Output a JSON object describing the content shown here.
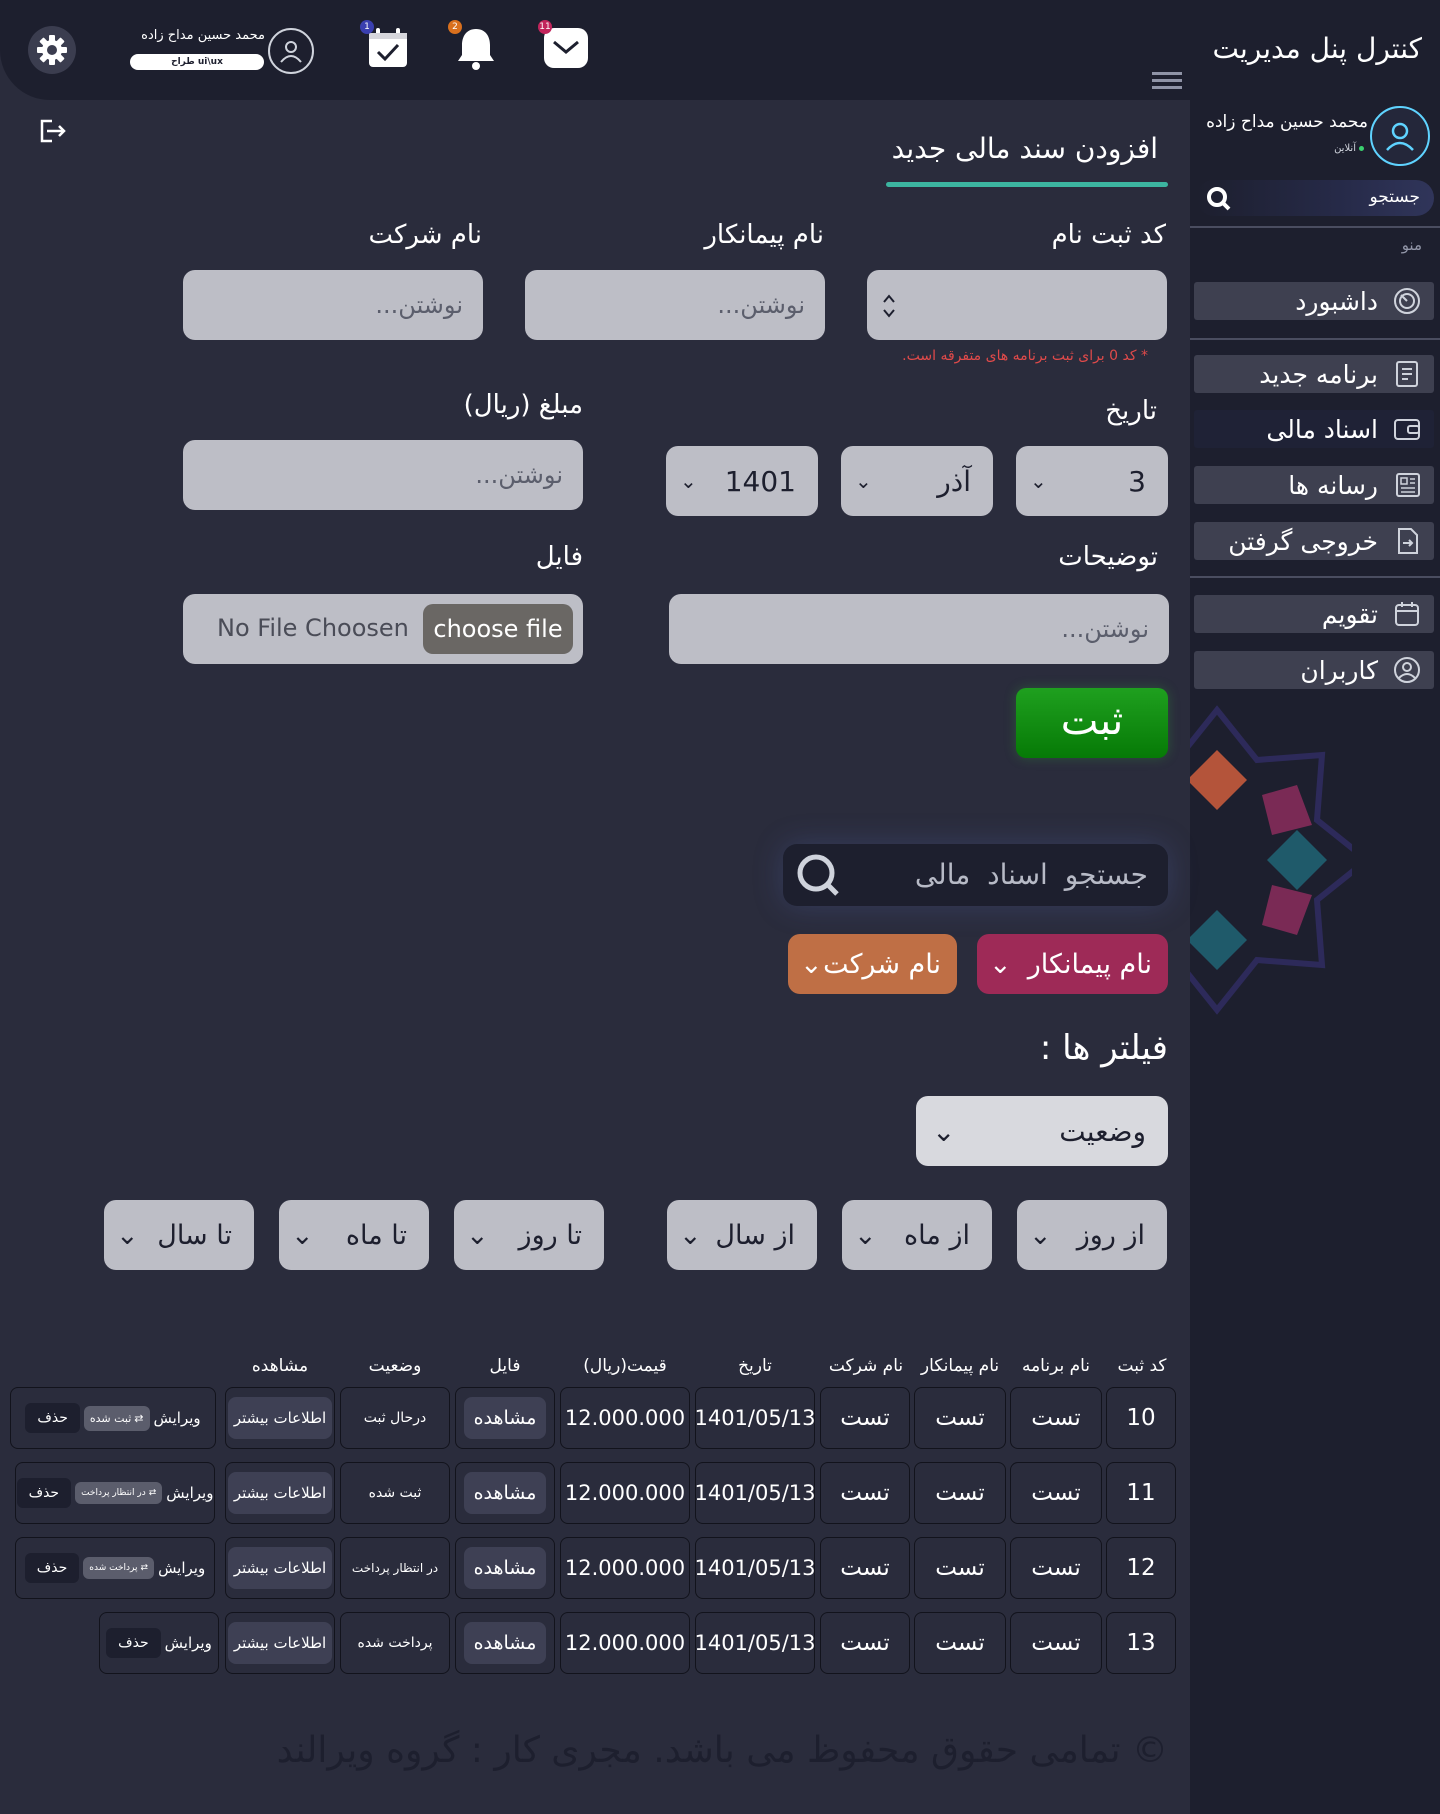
{
  "sidebar": {
    "title": "کنترل پنل مدیریت",
    "user_name": "محمد حسین مداح زاده",
    "status": "آنلاین",
    "search_placeholder": "جستجو",
    "menu_label": "منو",
    "items": [
      {
        "label": "داشبورد",
        "icon": "speedometer-icon"
      },
      {
        "label": "برنامه جدید",
        "icon": "document-icon"
      },
      {
        "label": "اسناد مالی",
        "icon": "wallet-icon",
        "active": true
      },
      {
        "label": "رسانه ها",
        "icon": "newspaper-icon"
      },
      {
        "label": "خروجی گرفتن",
        "icon": "export-icon"
      },
      {
        "label": "تقویم",
        "icon": "calendar-icon"
      },
      {
        "label": "کاربران",
        "icon": "user-icon"
      }
    ]
  },
  "header": {
    "user_name": "محمد حسین مداح زاده",
    "user_role": "طراح ui\\ux",
    "badges": {
      "calendar": "1",
      "notifications": "2",
      "messages": "11"
    }
  },
  "form": {
    "title": "افزودن سند مالی جدید",
    "reg_code_label": "کد ثبت نام",
    "contractor_label": "نام پیمانکار",
    "contractor_placeholder": "نوشتن...",
    "company_label": "نام شرکت",
    "company_placeholder": "نوشتن...",
    "hint": "* کد 0 برای ثبت برنامه های متفرقه است.",
    "date_label": "تاریخ",
    "day": "3",
    "month": "آذر",
    "year": "1401",
    "amount_label": "مبلغ (ریال)",
    "amount_placeholder": "نوشتن...",
    "desc_label": "توضیحات",
    "desc_placeholder": "نوشتن...",
    "file_label": "فایل",
    "file_placeholder": "No File Choosen",
    "file_button": "choose file",
    "submit": "ثبت"
  },
  "search": {
    "placeholder": "جستجو اسناد مالی",
    "chip_contractor": "نام پیمانکار",
    "chip_company": "نام شرکت",
    "filters_title": "فیلتر ها :",
    "status_select": "وضعیت",
    "from_day": "از روز",
    "from_month": "از ماه",
    "from_year": "از سال",
    "to_day": "تا روز",
    "to_month": "تا ماه",
    "to_year": "تا سال"
  },
  "table": {
    "headers": [
      "کد ثبت",
      "نام برنامه",
      "نام پیمانکار",
      "نام شرکت",
      "تاریخ",
      "قیمت(ریال)",
      "فایل",
      "وضعیت",
      "مشاهده"
    ],
    "view_label": "مشاهده",
    "more_label": "اطلاعات بیشتر",
    "edit_label": "ویرایش",
    "delete_label": "حذف",
    "rows": [
      {
        "code": "10",
        "program": "تست",
        "contractor": "تست",
        "company": "تست",
        "date": "1401/05/13",
        "price": "12.000.000",
        "status": "درحال ثبت",
        "next_state": "ثبت شده"
      },
      {
        "code": "11",
        "program": "تست",
        "contractor": "تست",
        "company": "تست",
        "date": "1401/05/13",
        "price": "12.000.000",
        "status": "ثبت شده",
        "next_state": "در انتظار پرداخت"
      },
      {
        "code": "12",
        "program": "تست",
        "contractor": "تست",
        "company": "تست",
        "date": "1401/05/13",
        "price": "12.000.000",
        "status": "در انتظار پرداخت",
        "next_state": "پرداخت شده"
      },
      {
        "code": "13",
        "program": "تست",
        "contractor": "تست",
        "company": "تست",
        "date": "1401/05/13",
        "price": "12.000.000",
        "status": "پرداخت شده",
        "next_state": ""
      }
    ]
  },
  "footer": "© تمامی حقوق محفوظ می باشد. مجری کار : گروه ویرالند",
  "colors": {
    "accent": "#3cb5a0",
    "submit": "#0c8a0c",
    "chip_contractor": "#9e2a57",
    "chip_company": "#bf6f45",
    "error": "#e04a4a"
  }
}
